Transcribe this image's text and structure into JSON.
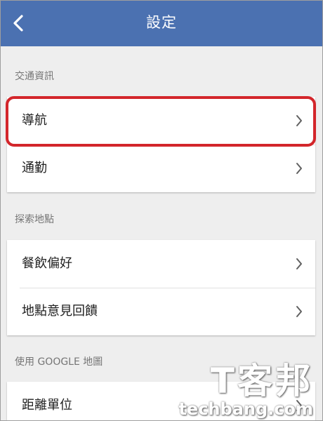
{
  "app_bar": {
    "title": "設定",
    "back_icon": "chevron-left-icon"
  },
  "sections": [
    {
      "header": "交通資訊",
      "items": [
        {
          "label": "導航",
          "icon": "chevron-right-icon",
          "highlighted": true
        },
        {
          "label": "通勤",
          "icon": "chevron-right-icon"
        }
      ]
    },
    {
      "header": "探索地點",
      "items": [
        {
          "label": "餐飲偏好",
          "icon": "chevron-right-icon"
        },
        {
          "label": "地點意見回饋",
          "icon": "chevron-right-icon"
        }
      ]
    },
    {
      "header": "使用 GOOGLE 地圖",
      "items": [
        {
          "label": "距離單位",
          "icon": "chevron-right-icon"
        }
      ]
    }
  ],
  "watermark": {
    "logo": "T客邦",
    "domain": "techbang.com"
  },
  "colors": {
    "app_bar": "#4b71b1",
    "background": "#eeeeee",
    "card": "#ffffff",
    "highlight": "#d3262b"
  }
}
